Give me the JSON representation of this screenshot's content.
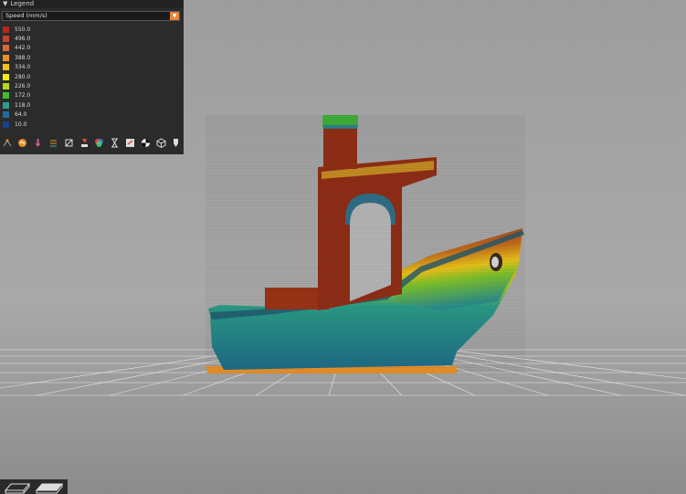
{
  "legend": {
    "title": "Legend",
    "view_type": "Speed (mm/s)",
    "items": [
      {
        "label": "550.0",
        "color": "#b3271e"
      },
      {
        "label": "496.0",
        "color": "#c8402f"
      },
      {
        "label": "442.0",
        "color": "#d6693a"
      },
      {
        "label": "388.0",
        "color": "#e88f2a"
      },
      {
        "label": "334.0",
        "color": "#f1c21b"
      },
      {
        "label": "280.0",
        "color": "#f4ed0f"
      },
      {
        "label": "226.0",
        "color": "#b5d81d"
      },
      {
        "label": "172.0",
        "color": "#44b92c"
      },
      {
        "label": "118.0",
        "color": "#2d9c8e"
      },
      {
        "label": "64.0",
        "color": "#236b9c"
      },
      {
        "label": "10.0",
        "color": "#1b3f8c"
      }
    ]
  },
  "toolbar": {
    "icons": [
      "travel-icon",
      "wipe-icon",
      "retractions-icon",
      "deretractions-icon",
      "seams-icon",
      "tool-changes-icon",
      "color-changes-icon",
      "pause-icon",
      "custom-gcode-icon",
      "center-of-gravity-icon",
      "shells-icon",
      "tool-marker-icon"
    ]
  },
  "colors": {
    "panel_bg": "#2b2b2b",
    "accent": "#e8833a",
    "viewport_bg": "#a3a3a3",
    "bed_grid": "#e6e6e6"
  }
}
